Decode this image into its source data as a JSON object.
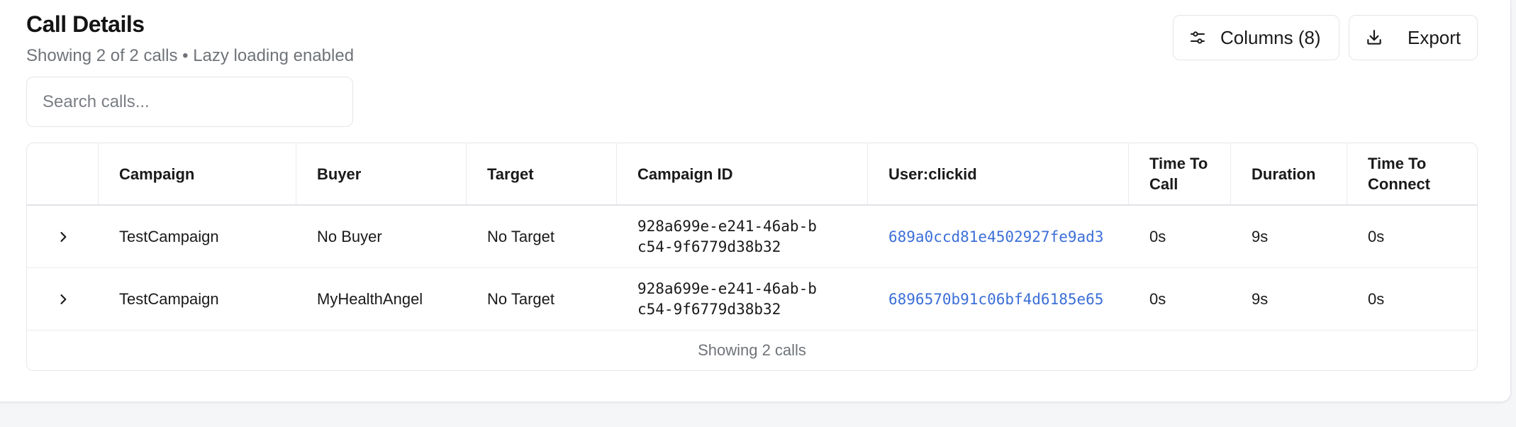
{
  "header": {
    "title": "Call Details",
    "subtitle": "Showing 2 of 2 calls • Lazy loading enabled"
  },
  "toolbar": {
    "columns_label": "Columns (8)",
    "columns_icon": "sliders-icon",
    "export_label": "Export",
    "export_icon": "download-icon"
  },
  "search": {
    "placeholder": "Search calls...",
    "value": ""
  },
  "table": {
    "columns": [
      {
        "label": "Campaign"
      },
      {
        "label": "Buyer"
      },
      {
        "label": "Target"
      },
      {
        "label": "Campaign ID"
      },
      {
        "label": "User:clickid"
      },
      {
        "label": "Time To Call"
      },
      {
        "label": "Duration"
      },
      {
        "label": "Time To Connect"
      }
    ],
    "rows": [
      {
        "campaign": "TestCampaign",
        "buyer": "No Buyer",
        "target": "No Target",
        "campaign_id": "928a699e-e241-46ab-bc54-9f6779d38b32",
        "clickid": "689a0ccd81e4502927fe9ad3",
        "time_to_call": "0s",
        "duration": "9s",
        "time_to_connect": "0s"
      },
      {
        "campaign": "TestCampaign",
        "buyer": "MyHealthAngel",
        "target": "No Target",
        "campaign_id": "928a699e-e241-46ab-bc54-9f6779d38b32",
        "clickid": "6896570b91c06bf4d6185e65",
        "time_to_call": "0s",
        "duration": "9s",
        "time_to_connect": "0s"
      }
    ],
    "footer": "Showing 2 calls"
  },
  "colors": {
    "link": "#3b6fd8",
    "muted_text": "#6f7378",
    "border": "#e6e8ec"
  }
}
